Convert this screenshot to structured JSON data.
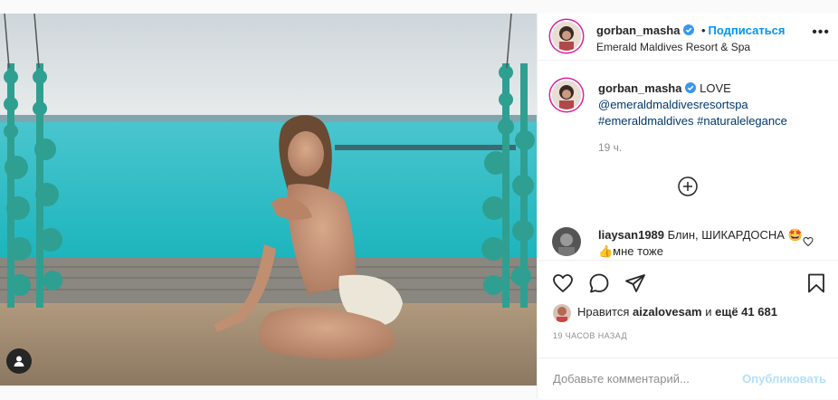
{
  "post": {
    "username": "gorban_masha",
    "follow_label": "Подписаться",
    "follow_separator": "•",
    "location": "Emerald Maldives Resort & Spa",
    "more_label": "•••",
    "caption_text": "LOVE",
    "caption_mention": "@emeraldmaldivesresortspa",
    "caption_tags": "#emeraldmaldives #naturalelegance",
    "caption_time": "19 ч.",
    "comment": {
      "username": "liaysan1989",
      "text": "Блин, ШИКАРДОСНА 🤩👍мне тоже"
    },
    "likes": {
      "prefix": "Нравится",
      "user": "aizalovesam",
      "middle": "и",
      "count": "ещё 41 681"
    },
    "time_ago": "19 ЧАСОВ НАЗАД",
    "add_comment_placeholder": "Добавьте комментарий...",
    "publish_label": "Опубликовать"
  },
  "colors": {
    "accent": "#0095f6",
    "link": "#00376b",
    "muted": "#8e8e8e",
    "story_ring": "#d6249f"
  },
  "icons": [
    "verified-icon",
    "more-icon",
    "plus-circle-icon",
    "heart-icon",
    "comment-icon",
    "share-icon",
    "bookmark-icon",
    "user-tag-icon"
  ]
}
